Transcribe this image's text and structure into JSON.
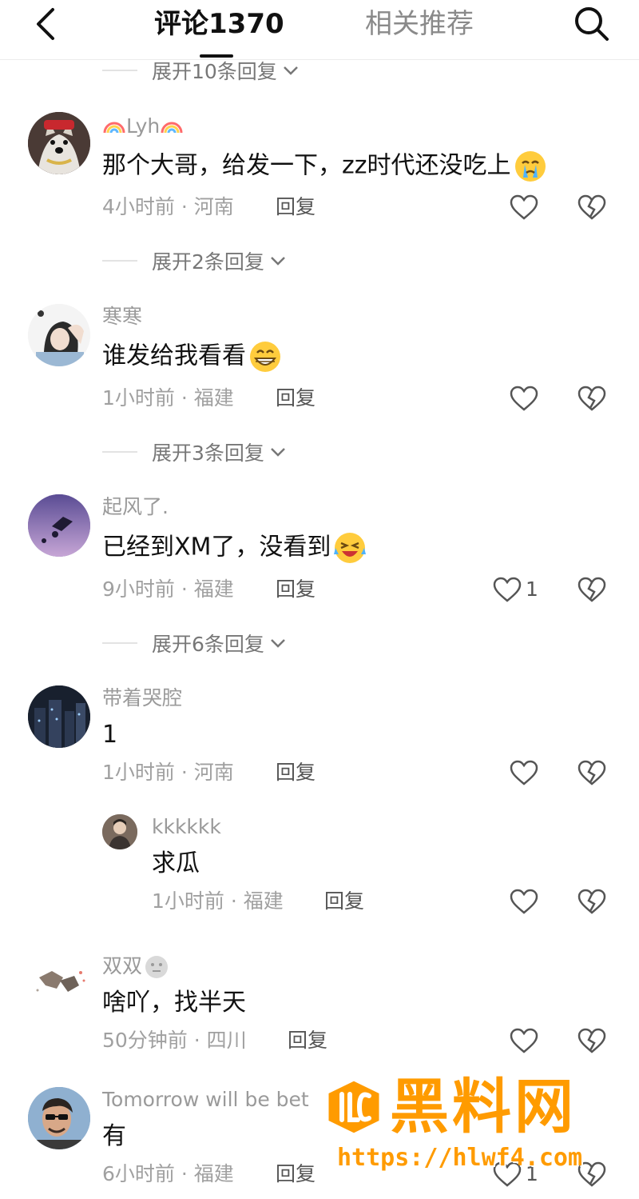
{
  "header": {
    "tab_comments": "评论1370",
    "tab_related": "相关推荐"
  },
  "expand_rows": [
    "展开10条回复",
    "展开2条回复",
    "展开3条回复",
    "展开6条回复"
  ],
  "comments": [
    {
      "user": "Lyh",
      "text": "那个大哥，给发一下，zz时代还没吃上",
      "time_loc": "4小时前 · 河南",
      "reply": "回复"
    },
    {
      "user": "寒寒",
      "text": "谁发给我看看",
      "time_loc": "1小时前 · 福建",
      "reply": "回复"
    },
    {
      "user": "起风了.",
      "text": "已经到XM了，没看到",
      "time_loc": "9小时前 · 福建",
      "reply": "回复",
      "likes": "1"
    },
    {
      "user": "带着哭腔",
      "text": "1",
      "time_loc": "1小时前 · 河南",
      "reply": "回复"
    },
    {
      "user": "kkkkkk",
      "text": "求瓜",
      "time_loc": "1小时前 · 福建",
      "reply": "回复"
    },
    {
      "user": "双双",
      "text": "啥吖，找半天",
      "time_loc": "50分钟前 · 四川",
      "reply": "回复"
    },
    {
      "user": "Tomorrow will be bet",
      "text": "有",
      "time_loc": "6小时前 · 福建",
      "reply": "回复",
      "likes": "1"
    }
  ],
  "icons": {
    "back": "chevron-left-icon",
    "search": "search-icon",
    "like": "heart-icon",
    "dislike": "broken-heart-icon",
    "expand": "chevron-down-icon"
  },
  "watermark": {
    "title": "黑料网",
    "url": "https://hlwf4.com",
    "color": "#ff9b00"
  }
}
